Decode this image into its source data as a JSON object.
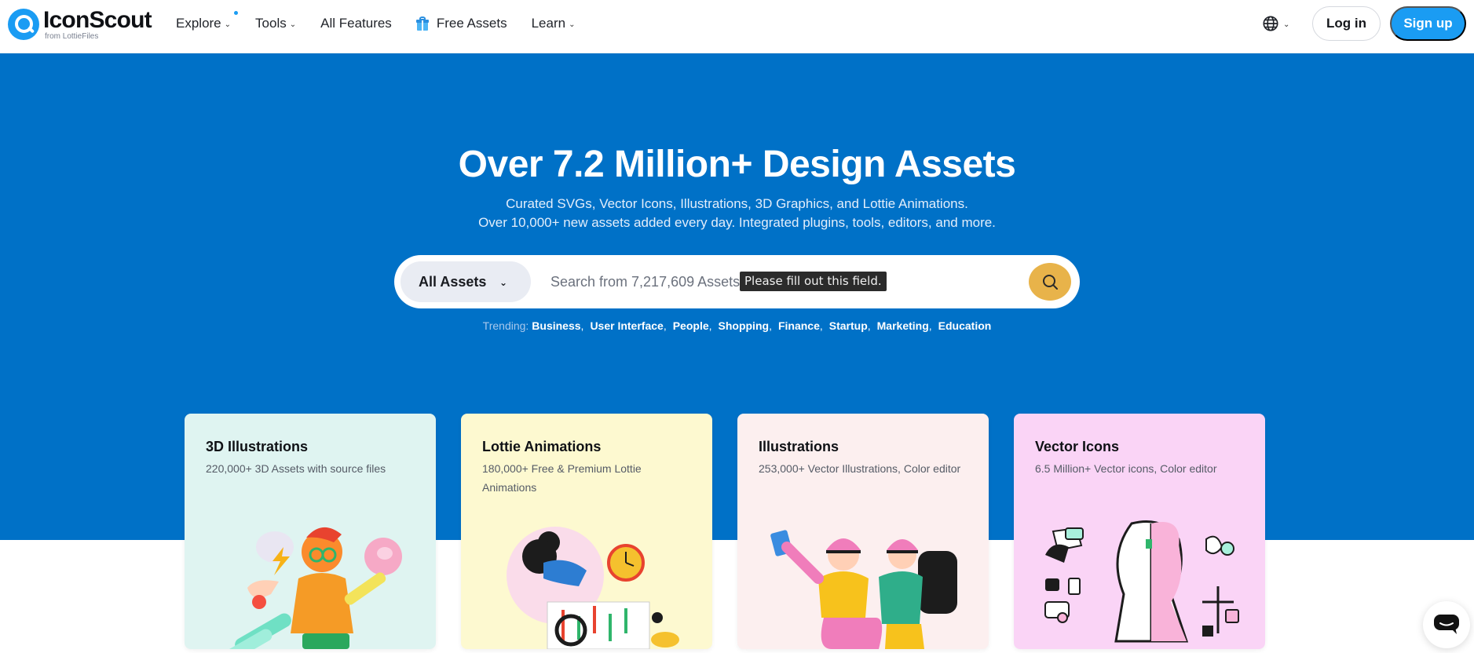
{
  "brand": {
    "name": "IconScout",
    "sub": "from LottieFiles",
    "accent": "#1a9cf3",
    "hero_bg": "#0071c7",
    "search_btn": "#e8b34a"
  },
  "nav": {
    "explore": "Explore",
    "tools": "Tools",
    "all_features": "All Features",
    "free_assets": "Free Assets",
    "learn": "Learn"
  },
  "header_actions": {
    "language_icon": "globe-icon",
    "login": "Log in",
    "signup": "Sign up"
  },
  "hero": {
    "title": "Over 7.2 Million+ Design Assets",
    "subtitle_line1": "Curated SVGs, Vector Icons, Illustrations, 3D Graphics, and Lottie Animations.",
    "subtitle_line2": "Over 10,000+ new assets added every day. Integrated plugins, tools, editors, and more."
  },
  "search": {
    "category": "All Assets",
    "placeholder": "Search from 7,217,609 Assets",
    "value": "",
    "validation_tooltip": "Please fill out this field.",
    "button_icon": "search-icon"
  },
  "trending": {
    "label": "Trending:",
    "items": [
      "Business",
      "User Interface",
      "People",
      "Shopping",
      "Finance",
      "Startup",
      "Marketing",
      "Education"
    ]
  },
  "cards": [
    {
      "title": "3D Illustrations",
      "desc": "220,000+ 3D Assets with source files",
      "bg": "#dff4f1"
    },
    {
      "title": "Lottie Animations",
      "desc": "180,000+ Free & Premium Lottie Animations",
      "bg": "#fdf9d0"
    },
    {
      "title": "Illustrations",
      "desc": "253,000+ Vector Illustrations, Color editor",
      "bg": "#fcefef"
    },
    {
      "title": "Vector Icons",
      "desc": "6.5 Million+ Vector icons, Color editor",
      "bg": "#fad4f6"
    }
  ],
  "chat": {
    "icon": "chat-bubble-icon"
  }
}
